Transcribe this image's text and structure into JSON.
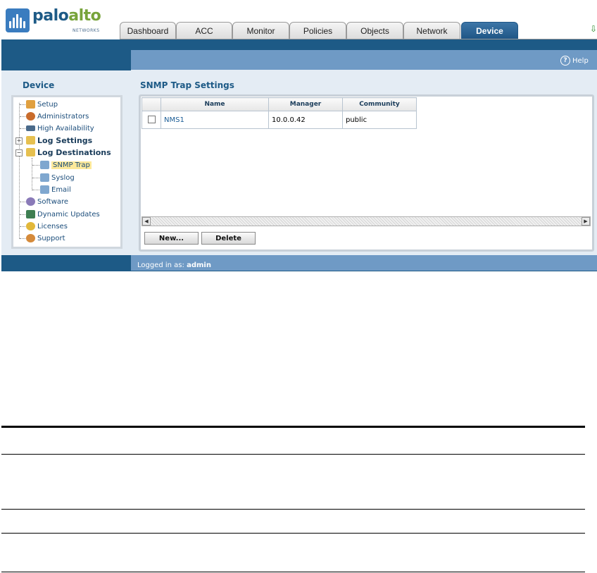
{
  "brand": {
    "word_a": "palo",
    "word_b": "alto",
    "sub": "NETWORKS",
    "colors": {
      "palo": "#1d5a86",
      "alto": "#77a33a",
      "accent": "#1d5a86"
    }
  },
  "tabs": [
    {
      "label": "Dashboard",
      "active": false
    },
    {
      "label": "ACC",
      "active": false
    },
    {
      "label": "Monitor",
      "active": false
    },
    {
      "label": "Policies",
      "active": false
    },
    {
      "label": "Objects",
      "active": false
    },
    {
      "label": "Network",
      "active": false
    },
    {
      "label": "Device",
      "active": true
    }
  ],
  "help": {
    "label": "Help",
    "icon": "help-icon"
  },
  "nav": {
    "title": "Device",
    "items": [
      {
        "label": "Setup",
        "icon": "setup-icon"
      },
      {
        "label": "Administrators",
        "icon": "administrators-icon"
      },
      {
        "label": "High Availability",
        "icon": "high-availability-icon"
      },
      {
        "label": "Log Settings",
        "icon": "log-settings-icon"
      },
      {
        "label": "Log Destinations",
        "icon": "log-destinations-icon"
      },
      {
        "label": "SNMP Trap",
        "icon": "snmp-trap-icon",
        "selected": true
      },
      {
        "label": "Syslog",
        "icon": "syslog-icon"
      },
      {
        "label": "Email",
        "icon": "email-icon"
      },
      {
        "label": "Software",
        "icon": "software-icon"
      },
      {
        "label": "Dynamic Updates",
        "icon": "dynamic-updates-icon"
      },
      {
        "label": "Licenses",
        "icon": "licenses-icon"
      },
      {
        "label": "Support",
        "icon": "support-icon"
      }
    ]
  },
  "panel": {
    "title": "SNMP Trap Settings",
    "columns": [
      "Name",
      "Manager",
      "Community"
    ],
    "rows": [
      {
        "name": "NMS1",
        "manager": "10.0.0.42",
        "community": "public"
      }
    ],
    "buttons": {
      "new": "New...",
      "delete": "Delete"
    }
  },
  "footer": {
    "prefix": "Logged in as:",
    "user": "admin"
  }
}
